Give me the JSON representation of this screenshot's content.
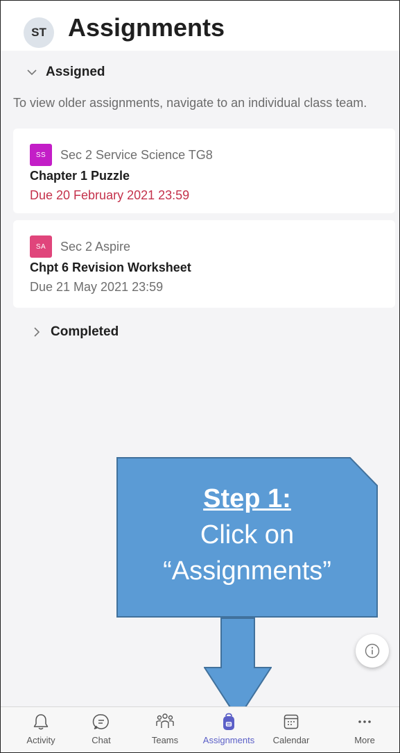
{
  "header": {
    "avatar_initials": "ST",
    "title": "Assignments"
  },
  "sections": {
    "assigned_label": "Assigned",
    "note": "To view older assignments, navigate to an individual class team.",
    "completed_label": "Completed"
  },
  "assignments": [
    {
      "badge": "SS",
      "badge_color": "#c31ec7",
      "class_name": "Sec 2 Service Science TG8",
      "title": "Chapter 1 Puzzle",
      "due": "Due 20 February 2021 23:59",
      "due_color": "#c4314b"
    },
    {
      "badge": "SA",
      "badge_color": "#e0457b",
      "class_name": "Sec 2 Aspire",
      "title": "Chpt 6 Revision Worksheet",
      "due": "Due 21 May 2021 23:59",
      "due_color": "#6e6e6e"
    }
  ],
  "callout": {
    "heading": "Step 1:",
    "line1": "Click on",
    "line2": "“Assignments”"
  },
  "nav": {
    "activity": "Activity",
    "chat": "Chat",
    "teams": "Teams",
    "assignments": "Assignments",
    "calendar": "Calendar",
    "more": "More"
  },
  "colors": {
    "accent": "#5b5fc7",
    "callout_fill": "#5b9bd5",
    "callout_stroke": "#41719c"
  }
}
